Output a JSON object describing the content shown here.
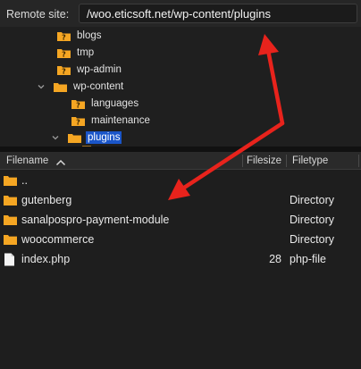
{
  "remote_site": {
    "label": "Remote site:",
    "path": "/woo.eticsoft.net/wp-content/plugins"
  },
  "tree": {
    "items": [
      {
        "label": "blogs",
        "expanded": null,
        "locked": true
      },
      {
        "label": "tmp",
        "expanded": null,
        "locked": true
      },
      {
        "label": "wp-admin",
        "expanded": null,
        "locked": true
      },
      {
        "label": "wp-content",
        "expanded": true,
        "locked": false
      },
      {
        "label": "languages",
        "expanded": null,
        "locked": true
      },
      {
        "label": "maintenance",
        "expanded": null,
        "locked": true
      },
      {
        "label": "plugins",
        "expanded": true,
        "locked": false,
        "selected": true
      }
    ]
  },
  "file_list": {
    "columns": {
      "filename": "Filename",
      "filesize": "Filesize",
      "filetype": "Filetype"
    },
    "rows": [
      {
        "name": "..",
        "size": "",
        "type": "",
        "kind": "folder"
      },
      {
        "name": "gutenberg",
        "size": "",
        "type": "Directory",
        "kind": "folder"
      },
      {
        "name": "sanalpospro-payment-module",
        "size": "",
        "type": "Directory",
        "kind": "folder"
      },
      {
        "name": "woocommerce",
        "size": "",
        "type": "Directory",
        "kind": "folder"
      },
      {
        "name": "index.php",
        "size": "28",
        "type": "php-file",
        "kind": "file"
      }
    ]
  },
  "colors": {
    "folder": "#f5a623",
    "selection": "#1a55c8",
    "annotation_arrow": "#e8231c"
  }
}
